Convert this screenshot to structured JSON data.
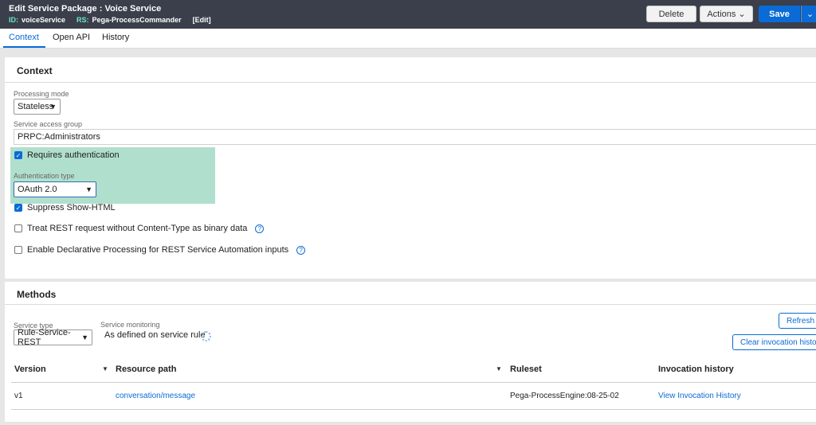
{
  "header": {
    "title": "Edit  Service Package : Voice Service",
    "id_label": "ID:",
    "id_value": "voiceService",
    "rs_label": "RS:",
    "rs_value": "Pega-ProcessCommander",
    "edit": "[Edit]",
    "buttons": {
      "delete": "Delete",
      "actions": "Actions",
      "save": "Save"
    }
  },
  "tabs": [
    "Context",
    "Open API",
    "History"
  ],
  "context": {
    "title": "Context",
    "processing_mode_label": "Processing mode",
    "processing_mode_value": "Stateless",
    "access_group_label": "Service access group",
    "access_group_value": "PRPC:Administrators",
    "requires_auth_label": "Requires authentication",
    "auth_type_label": "Authentication type",
    "auth_type_value": "OAuth 2.0",
    "suppress_label": "Suppress Show-HTML",
    "treat_rest_label": "Treat REST request without Content-Type as binary data",
    "declarative_label": "Enable Declarative Processing for REST Service Automation inputs"
  },
  "methods": {
    "title": "Methods",
    "service_type_label": "Service type",
    "service_type_value": "Rule-Service-REST",
    "monitoring_label": "Service monitoring",
    "monitoring_value": "As defined on service rule",
    "refresh_button": "Refresh",
    "clear_button": "Clear invocation history",
    "columns": [
      "Version",
      "Resource path",
      "Ruleset",
      "Invocation history"
    ],
    "rows": [
      {
        "version": "v1",
        "resource_path": "conversation/message",
        "ruleset": "Pega-ProcessEngine:08-25-02",
        "invocation": "View Invocation History"
      }
    ]
  },
  "colors": {
    "accent": "#0b6bd6",
    "header_bg": "#3a3f4b",
    "highlight": "#a9dcc8"
  }
}
